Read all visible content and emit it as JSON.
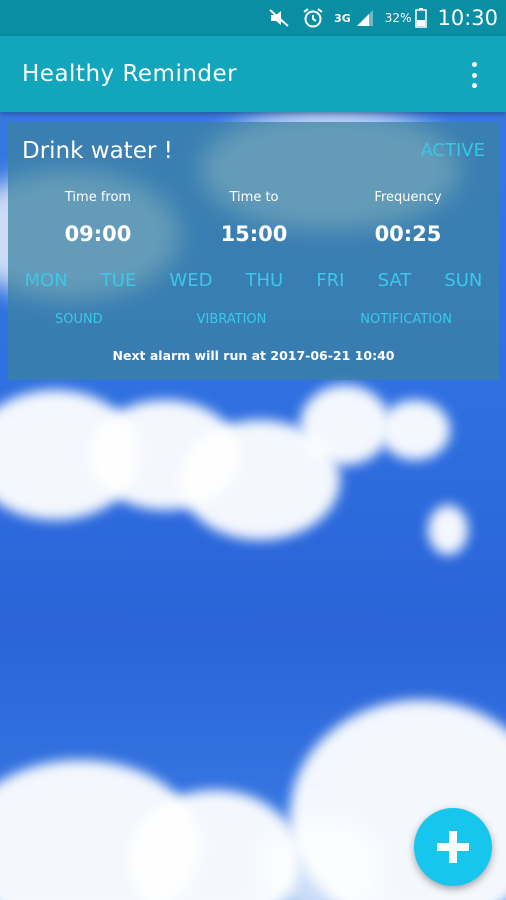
{
  "status_bar": {
    "network": "3G",
    "battery_percent": "32%",
    "time": "10:30",
    "icons": [
      "mute-icon",
      "alarm-icon",
      "network-3g-icon",
      "signal-icon",
      "battery-icon"
    ]
  },
  "app_bar": {
    "title": "Healthy Reminder",
    "menu_icon": "overflow-menu-icon"
  },
  "reminder": {
    "title": "Drink water !",
    "status": "ACTIVE",
    "time_from_label": "Time from",
    "time_from_value": "09:00",
    "time_to_label": "Time to",
    "time_to_value": "15:00",
    "frequency_label": "Frequency",
    "frequency_value": "00:25",
    "days": [
      "MON",
      "TUE",
      "WED",
      "THU",
      "FRI",
      "SAT",
      "SUN"
    ],
    "options": [
      "SOUND",
      "VIBRATION",
      "NOTIFICATION"
    ],
    "next_alarm": "Next alarm will run at 2017-06-21 10:40"
  },
  "fab": {
    "icon": "plus-icon"
  },
  "colors": {
    "status_bar": "#0a8ea3",
    "app_bar": "#12a6bd",
    "accent": "#3cc8e8",
    "fab": "#17c6ec"
  }
}
